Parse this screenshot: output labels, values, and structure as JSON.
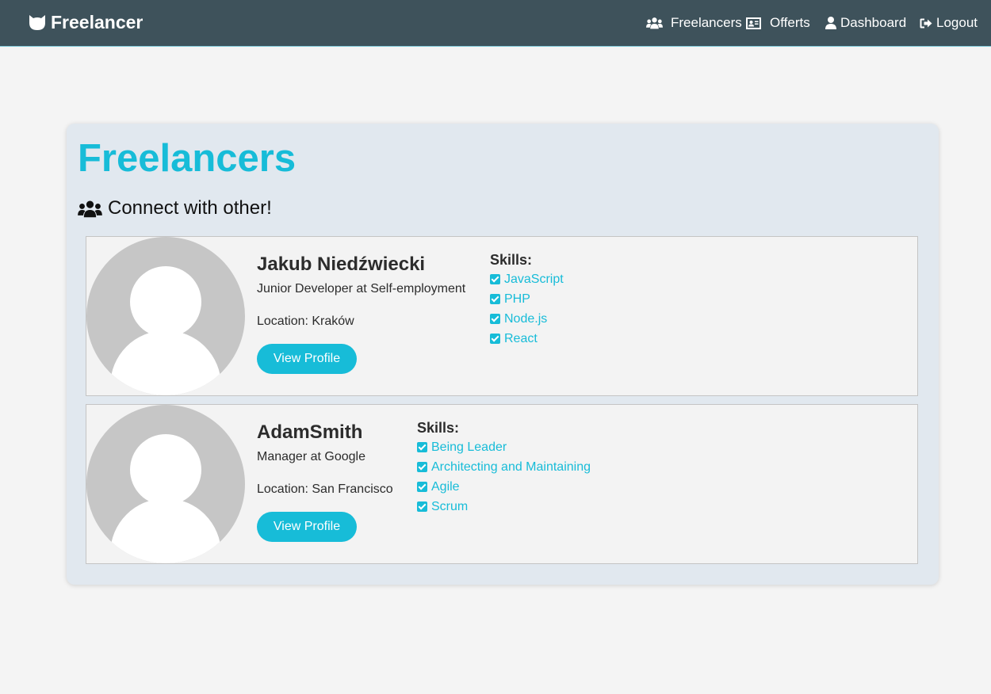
{
  "nav": {
    "brand": "Freelancer",
    "items": [
      {
        "label": "Freelancers",
        "icon": "users-icon"
      },
      {
        "label": "Offerts",
        "icon": "id-card-icon"
      },
      {
        "label": "Dashboard",
        "icon": "user-icon"
      },
      {
        "label": "Logout",
        "icon": "sign-out-icon"
      }
    ]
  },
  "page": {
    "title": "Freelancers",
    "subtitle": "Connect with other!",
    "skills_title": "Skills:",
    "view_profile_label": "View Profile"
  },
  "freelancers": [
    {
      "name": "Jakub Niedźwiecki",
      "position": "Junior Developer at Self-employment",
      "location": "Location: Kraków",
      "skills": [
        "JavaScript",
        "PHP",
        "Node.js",
        "React"
      ]
    },
    {
      "name": "AdamSmith",
      "position": "Manager at Google",
      "location": "Location: San Francisco",
      "skills": [
        "Being Leader",
        "Architecting and Maintaining",
        "Agile",
        "Scrum"
      ]
    }
  ],
  "colors": {
    "navbar": "#3e525b",
    "accent": "#17bcd8",
    "panel": "#e1e8ef",
    "background": "#f4f4f4"
  }
}
